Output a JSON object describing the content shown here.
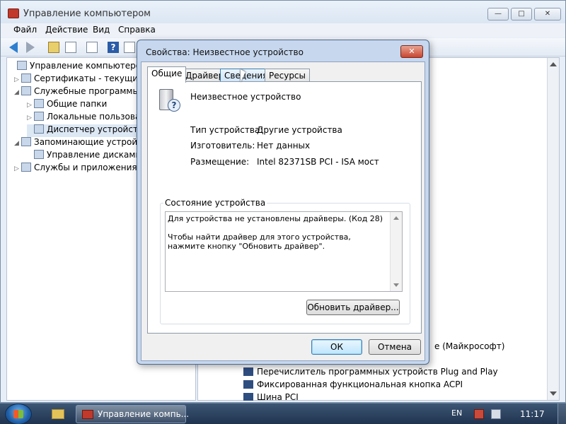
{
  "main_window": {
    "title": "Управление компьютером",
    "menu": [
      "Файл",
      "Действие",
      "Вид",
      "Справка"
    ],
    "caption_buttons": {
      "minimize": "—",
      "maximize": "□",
      "close": "✕"
    }
  },
  "tree": {
    "items": [
      {
        "label": "Управление компьютером (л",
        "expander": "",
        "icon": "computer-management-icon"
      },
      {
        "label": "Сертификаты - текущий п",
        "expander": "▷",
        "icon": "certificates-icon"
      },
      {
        "label": "Служебные программы",
        "expander": "◢",
        "icon": "tools-icon"
      },
      {
        "label": "Общие папки",
        "expander": "▷",
        "icon": "shared-folder-icon"
      },
      {
        "label": "Локальные пользовате",
        "expander": "▷",
        "icon": "users-icon"
      },
      {
        "label": "Диспетчер устройств",
        "expander": "",
        "icon": "device-manager-icon"
      },
      {
        "label": "Запоминающие устройст",
        "expander": "◢",
        "icon": "storage-icon"
      },
      {
        "label": "Управление дисками",
        "expander": "",
        "icon": "disk-management-icon"
      },
      {
        "label": "Службы и приложения",
        "expander": "▷",
        "icon": "services-icon"
      }
    ]
  },
  "device_list": {
    "fragment": "е (Майкрософт)",
    "items": [
      "Перечислитель программных устройств Plug and Play",
      "Фиксированная функциональная кнопка ACPI",
      "Шина PCI"
    ]
  },
  "dialog": {
    "title": "Свойства: Неизвестное устройство",
    "close": "✕",
    "tabs": [
      "Общие",
      "Драйвер",
      "Сведения",
      "Ресурсы"
    ],
    "device_name": "Неизвестное устройство",
    "properties": [
      {
        "label": "Тип устройства:",
        "value": "Другие устройства"
      },
      {
        "label": "Изготовитель:",
        "value": "Нет данных"
      },
      {
        "label": "Размещение:",
        "value": "Intel 82371SB PCI - ISA мост"
      }
    ],
    "status_group_title": "Состояние устройства",
    "status_text": "Для устройства не установлены драйверы. (Код 28)\n\nЧтобы найти драйвер для этого устройства, нажмите кнопку \"Обновить драйвер\".",
    "update_driver_button": "Обновить драйвер...",
    "ok_button": "ОК",
    "cancel_button": "Отмена"
  },
  "taskbar": {
    "task_label": "Управление компь...",
    "language": "EN",
    "clock": "11:17"
  }
}
